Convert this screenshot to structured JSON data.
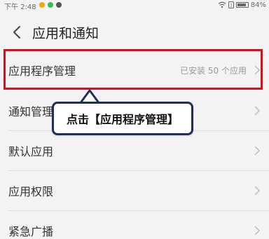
{
  "status_bar": {
    "time": "下午 2:48",
    "battery_text": "84%",
    "battery_level": 0.84,
    "dot_colors": [
      "#f2a900",
      "#3cba54",
      "#555555"
    ]
  },
  "header": {
    "title": "应用和通知"
  },
  "rows": [
    {
      "label": "应用程序管理",
      "value": "已安装 50 个应用"
    },
    {
      "label": "通知管理"
    },
    {
      "label": "默认应用"
    },
    {
      "label": "应用权限"
    },
    {
      "label": "紧急广播"
    }
  ],
  "callout": {
    "text": "点击【应用程序管理】"
  },
  "colors": {
    "highlight": "#d8101c",
    "callout_border": "#1e2f5a",
    "background": "#f3f3f3"
  }
}
